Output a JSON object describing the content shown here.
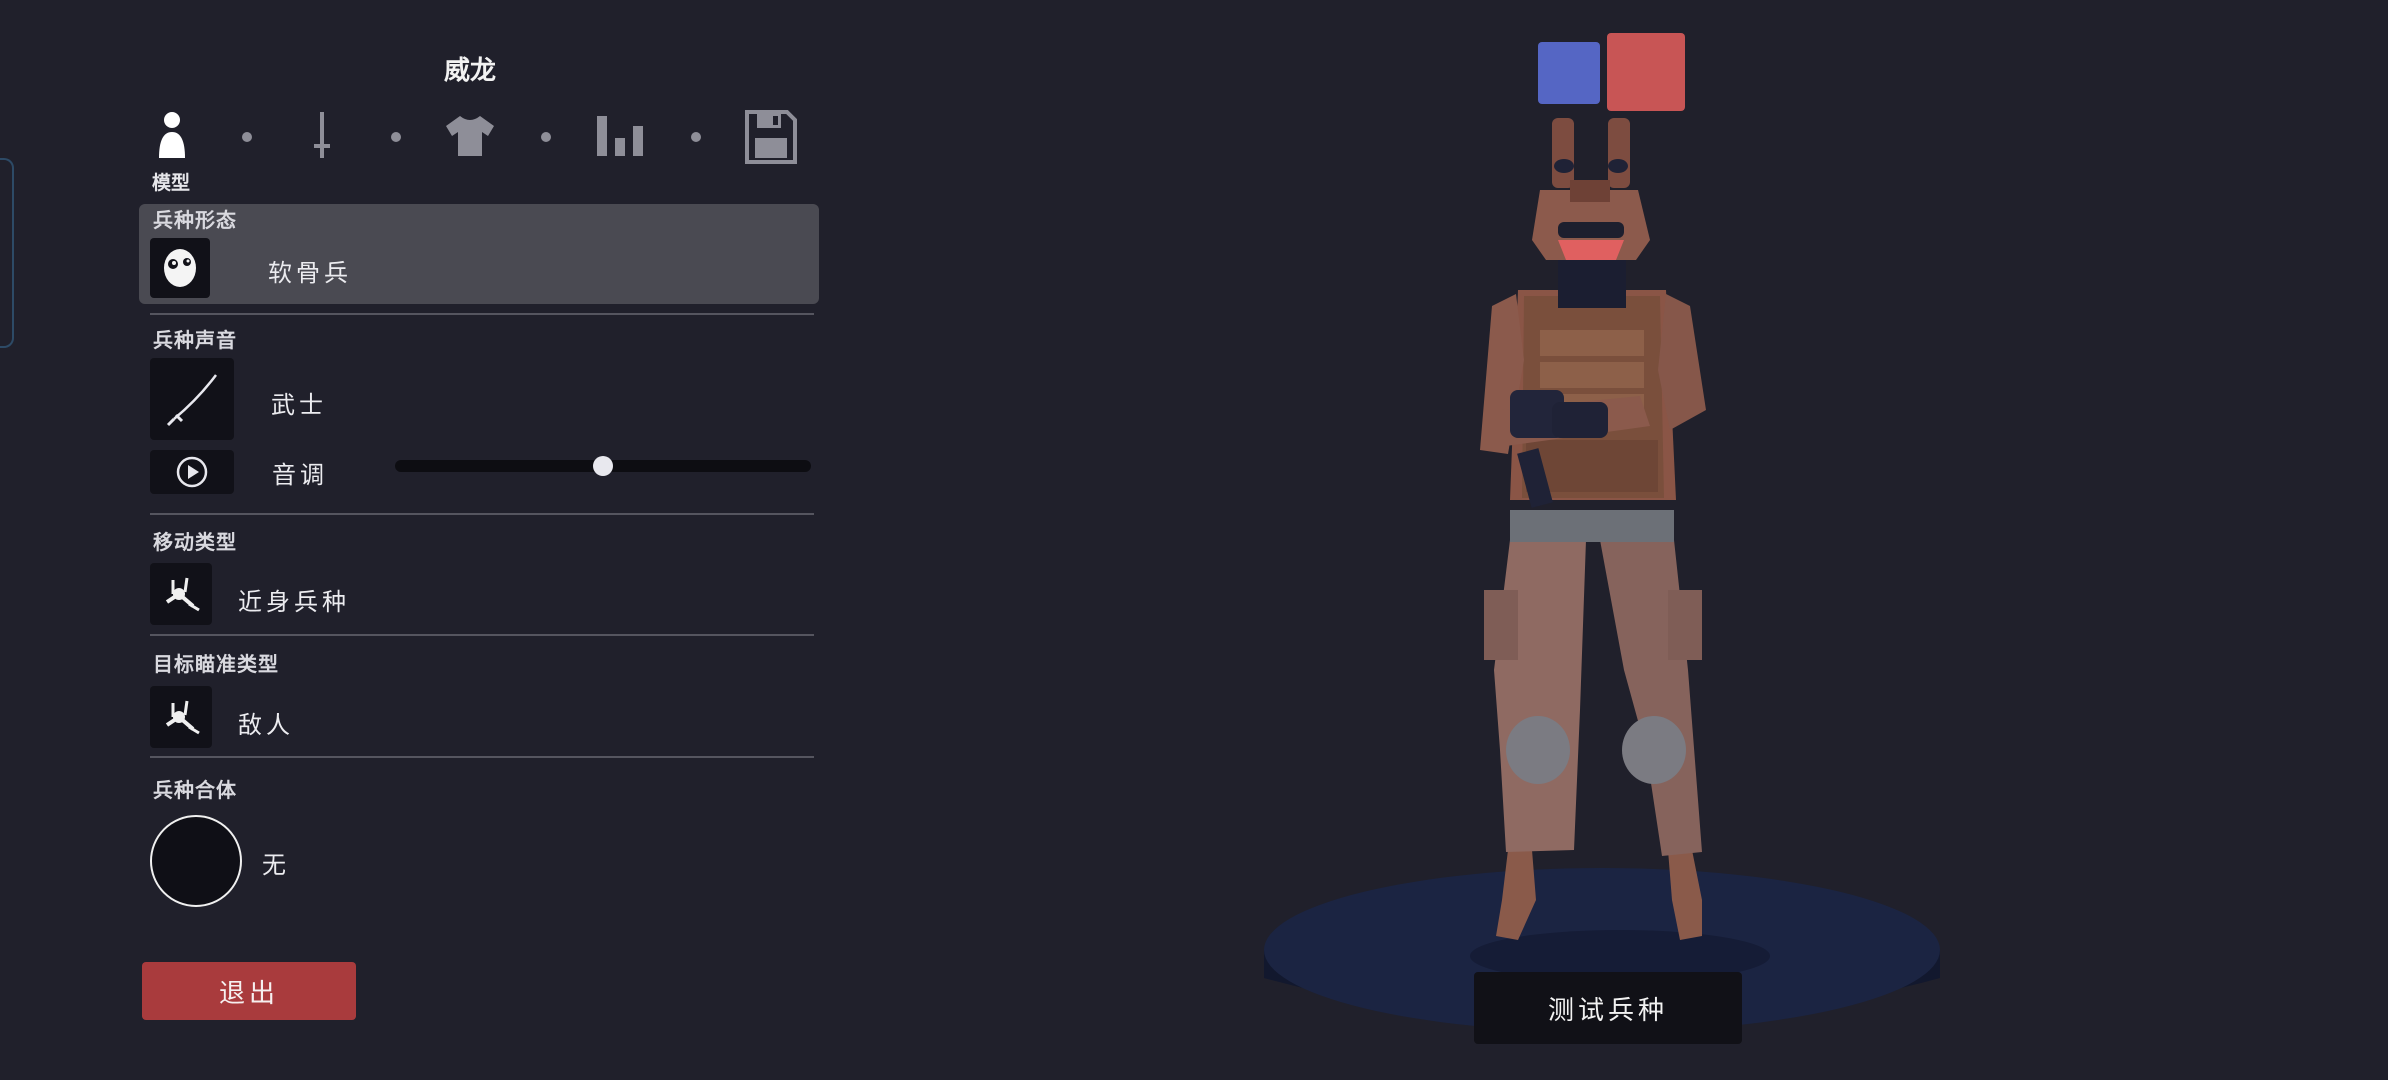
{
  "unit": {
    "name": "威龙"
  },
  "tabs": {
    "items": [
      {
        "icon": "person-icon"
      },
      {
        "icon": "sword-icon"
      },
      {
        "icon": "shirt-icon"
      },
      {
        "icon": "stats-icon"
      },
      {
        "icon": "save-icon"
      }
    ],
    "active_label": "模型"
  },
  "sections": {
    "form": {
      "label": "兵种形态",
      "value": "软骨兵",
      "icon": "skull-face-icon"
    },
    "voice": {
      "label": "兵种声音",
      "value": "武士",
      "icon": "katana-icon",
      "pitch_label": "音调",
      "pitch_level": 0.5,
      "play_icon": "play-icon"
    },
    "movement": {
      "label": "移动类型",
      "value": "近身兵种",
      "icon": "melee-icon"
    },
    "targeting": {
      "label": "目标瞄准类型",
      "value": "敌人",
      "icon": "melee-icon"
    },
    "combine": {
      "label": "兵种合体",
      "value": "无"
    }
  },
  "buttons": {
    "exit": "退出",
    "test_unit": "测试兵种"
  },
  "colors": {
    "background": "#20202b",
    "team_blue": "#5566c4",
    "team_red": "#c85555",
    "exit_button": "#a93b3d",
    "stage": "#18203e"
  }
}
